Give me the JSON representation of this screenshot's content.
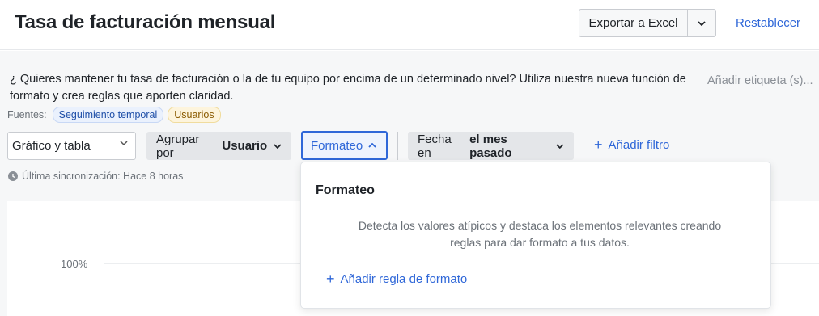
{
  "header": {
    "title": "Tasa de facturación mensual",
    "export_label": "Exportar a Excel",
    "reset_label": "Restablecer"
  },
  "info": {
    "description": "¿ Quieres mantener tu tasa de facturación o la de tu equipo por encima de un determinado nivel? Utiliza nuestra nueva función de formato y crea reglas que aporten claridad.",
    "add_tag": "Añadir etiqueta (s)...",
    "sources_label": "Fuentes:",
    "sources": [
      "Seguimiento temporal",
      "Usuarios"
    ]
  },
  "controls": {
    "view_select": "Gráfico y tabla",
    "group_prefix": "Agrupar por",
    "group_value": "Usuario",
    "format_label": "Formateo",
    "date_prefix": "Fecha en",
    "date_value": "el mes pasado",
    "add_filter": "Añadir filtro"
  },
  "sync": {
    "text": "Última sincronización: Hace 8 horas"
  },
  "chart": {
    "y_tick": "100%"
  },
  "popover": {
    "title": "Formateo",
    "description": "Detecta los valores atípicos y destaca los elementos relevantes creando reglas para dar formato a tus datos.",
    "add_rule": "Añadir regla de formato"
  },
  "colors": {
    "accent": "#2f67d8",
    "chip_blue": "#eaf1fd",
    "chip_yellow": "#fdf4dc"
  }
}
